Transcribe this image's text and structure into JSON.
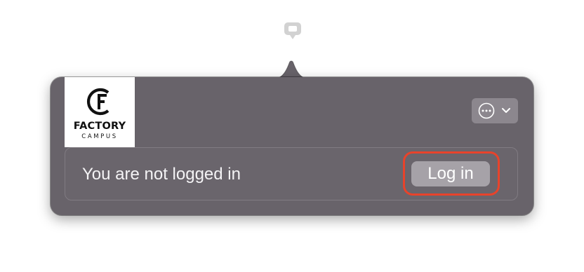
{
  "menubar": {
    "icon": "menu-extra-icon"
  },
  "popover": {
    "logo": {
      "name": "FACTORY",
      "subtitle": "CAMPUS",
      "icon": "factory-campus-logo"
    },
    "more_button": {
      "icon": "ellipsis-circle-icon",
      "dropdown_icon": "chevron-down-icon"
    },
    "status_text": "You are not logged in",
    "login_label": "Log in"
  },
  "colors": {
    "popover_bg": "#68636a",
    "button_bg": "#a6a2a8",
    "highlight": "#e8432b",
    "text": "#f4f3f5"
  }
}
